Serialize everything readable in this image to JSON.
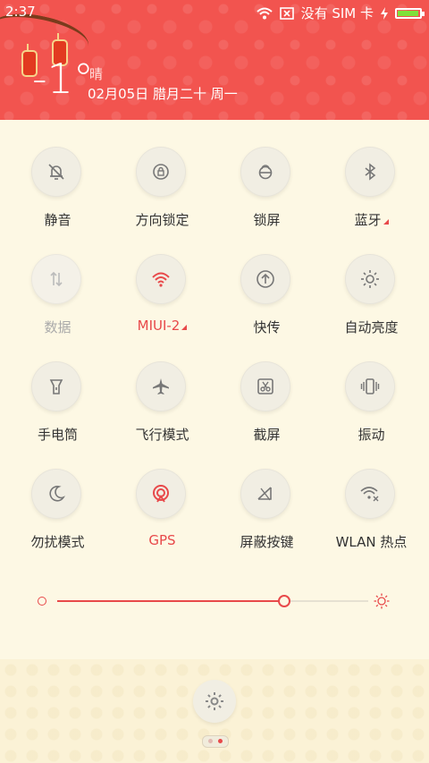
{
  "status_bar": {
    "time": "2:37",
    "carrier": "没有 SIM 卡",
    "battery_percent": 95,
    "icons": [
      "wifi-icon",
      "no-sim-icon",
      "charging-icon",
      "battery-icon"
    ]
  },
  "weather": {
    "temperature": "-1°",
    "condition": "晴",
    "date": "02月05日 腊月二十 周一"
  },
  "colors": {
    "accent": "#e8494a",
    "header": "#f2544f",
    "background": "#fdf8e4"
  },
  "toggles": [
    {
      "label": "静音",
      "icon": "bell-mute-icon",
      "state": "off"
    },
    {
      "label": "方向锁定",
      "icon": "rotation-lock-icon",
      "state": "off"
    },
    {
      "label": "锁屏",
      "icon": "lock-icon",
      "state": "off"
    },
    {
      "label": "蓝牙",
      "icon": "bluetooth-icon",
      "state": "off",
      "has_menu": true
    },
    {
      "label": "数据",
      "icon": "data-icon",
      "state": "disabled"
    },
    {
      "label": "MIUI-2",
      "icon": "wifi-icon",
      "state": "on",
      "has_menu": true
    },
    {
      "label": "快传",
      "icon": "upload-icon",
      "state": "off"
    },
    {
      "label": "自动亮度",
      "icon": "auto-brightness-icon",
      "state": "off"
    },
    {
      "label": "手电筒",
      "icon": "flashlight-icon",
      "state": "off"
    },
    {
      "label": "飞行模式",
      "icon": "airplane-icon",
      "state": "off"
    },
    {
      "label": "截屏",
      "icon": "screenshot-icon",
      "state": "off"
    },
    {
      "label": "振动",
      "icon": "vibrate-icon",
      "state": "off"
    },
    {
      "label": "勿扰模式",
      "icon": "moon-icon",
      "state": "off"
    },
    {
      "label": "GPS",
      "icon": "gps-icon",
      "state": "on"
    },
    {
      "label": "屏蔽按键",
      "icon": "block-keys-icon",
      "state": "off"
    },
    {
      "label": "WLAN 热点",
      "icon": "hotspot-icon",
      "state": "off"
    }
  ],
  "brightness": {
    "level": 0.73
  },
  "footer": {
    "settings_icon": "gear-icon",
    "page_count": 2,
    "current_page": 2
  }
}
